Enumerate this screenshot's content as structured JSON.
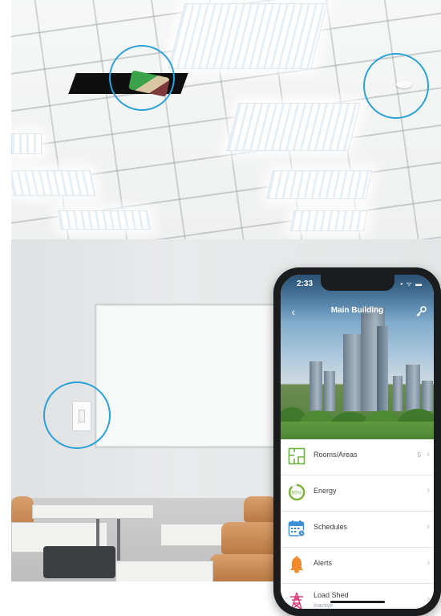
{
  "app": {
    "status_time": "2:33",
    "status_icons": "▪︎ ᯤ ▬",
    "title": "Main Building",
    "back_glyph": "‹"
  },
  "menu": [
    {
      "id": "rooms",
      "label": "Rooms/Areas",
      "count": "5",
      "sub": "",
      "icon": "floorplan-icon"
    },
    {
      "id": "energy",
      "label": "Energy",
      "count": "",
      "sub": "",
      "icon": "energy-gauge-icon",
      "badge": "95%"
    },
    {
      "id": "schedules",
      "label": "Schedules",
      "count": "",
      "sub": "",
      "icon": "calendar-icon"
    },
    {
      "id": "alerts",
      "label": "Alerts",
      "count": "",
      "sub": "",
      "icon": "bell-icon"
    },
    {
      "id": "loadshed",
      "label": "Load Shed",
      "count": "",
      "sub": "Inactive",
      "icon": "power-tower-icon"
    }
  ],
  "chevron": "›",
  "colors": {
    "highlight": "#2aa2d8",
    "accent_green": "#7bb23a",
    "accent_blue": "#3f8fd8",
    "accent_orange": "#f08a2c",
    "accent_pink": "#e0417f"
  }
}
